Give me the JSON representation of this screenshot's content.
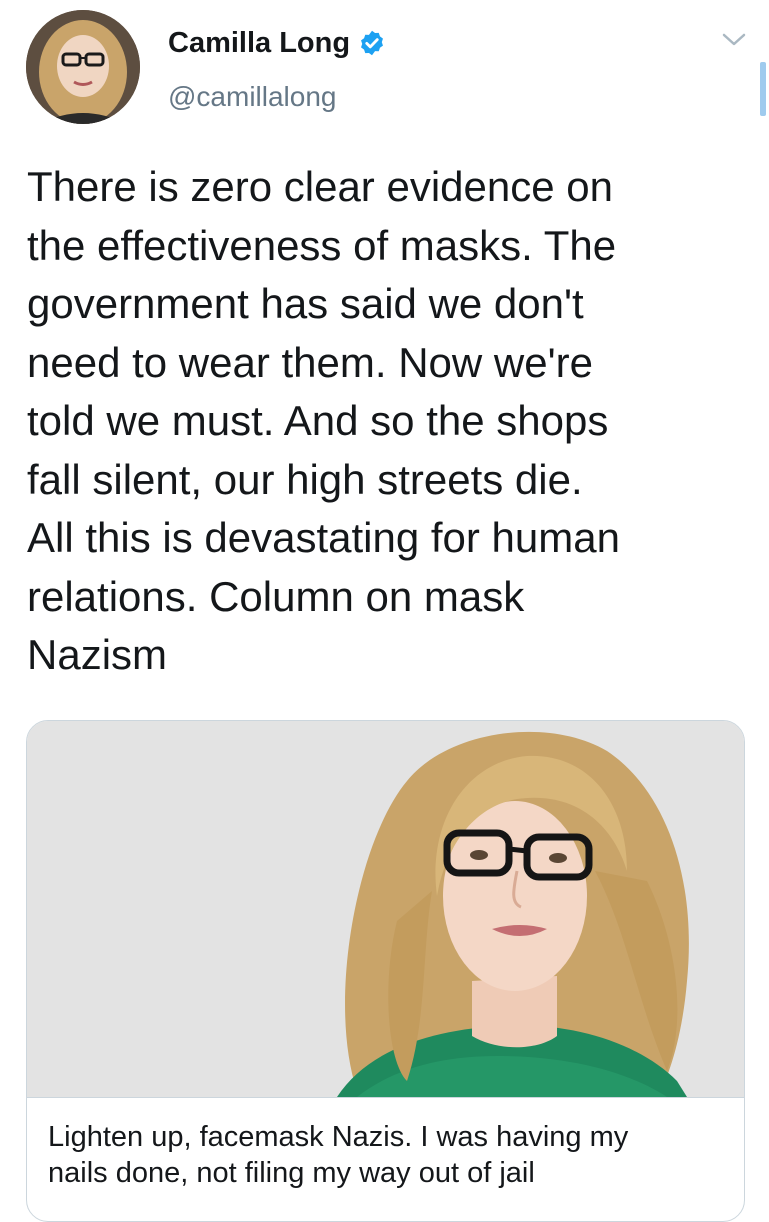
{
  "author": {
    "name": "Camilla Long",
    "handle": "@camillalong",
    "verified": true,
    "avatar_icon": "profile-photo"
  },
  "menu": {
    "icon": "chevron-down-icon"
  },
  "tweet": {
    "text": "There is zero clear evidence on\nthe effectiveness of masks. The\ngovernment has said we don't\nneed to wear them. Now we're\ntold we must. And so the shops\nfall silent, our high streets die.\nAll this is devastating for human\nrelations. Column on mask\nNazism"
  },
  "link_card": {
    "image_icon": "portrait-photo",
    "title": "Lighten up, facemask Nazis. I was having my\nnails done, not filing my way out of jail"
  },
  "colors": {
    "verified_blue": "#1da1f2",
    "handle_gray": "#657786",
    "text": "#14171a",
    "card_border": "#ccd6dd",
    "scroll_indicator": "#9fcbee"
  }
}
